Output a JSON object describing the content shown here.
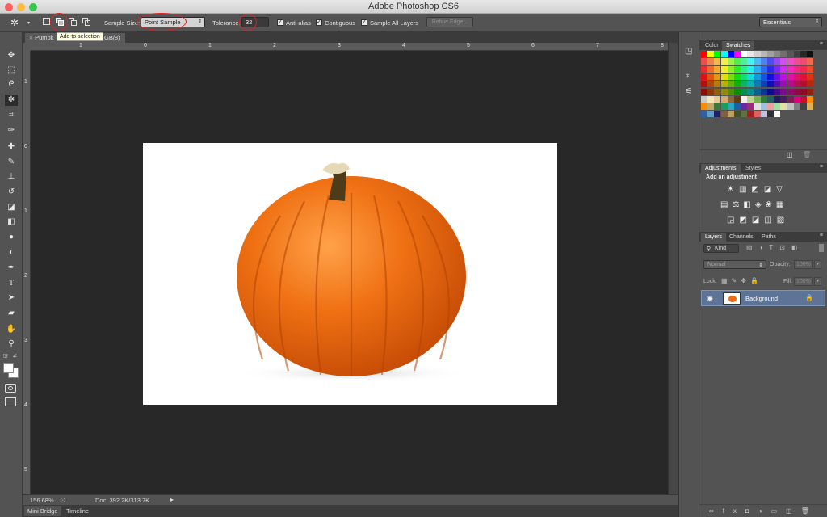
{
  "app_title": "Adobe Photoshop CS6",
  "options_bar": {
    "sample_size_label": "Sample Size:",
    "sample_size_value": "Point Sample",
    "tolerance_label": "Tolerance:",
    "tolerance_value": "32",
    "anti_alias_label": "Anti-alias",
    "contiguous_label": "Contiguous",
    "sample_all_layers_label": "Sample All Layers",
    "refine_edge_label": "Refine Edge...",
    "workspace_value": "Essentials",
    "tooltip": "Add to selection"
  },
  "document": {
    "tab_name_left": "Pumpk",
    "tab_name_right": "GB/8)",
    "ruler_h": [
      "1",
      "0",
      "1",
      "2",
      "3",
      "4",
      "5",
      "6",
      "7",
      "8"
    ],
    "ruler_v": [
      "1",
      "0",
      "1",
      "2",
      "3",
      "4",
      "5"
    ]
  },
  "status_bar": {
    "zoom": "156.68%",
    "doc_size": "Doc: 392.2K/313.7K"
  },
  "bottom_tabs": [
    "Mini Bridge",
    "Timeline"
  ],
  "color_panel": {
    "tabs": [
      "Color",
      "Swatches"
    ],
    "active_tab": "Swatches"
  },
  "adjustments_panel": {
    "tabs": [
      "Adjustments",
      "Styles"
    ],
    "heading": "Add an adjustment"
  },
  "layers_panel": {
    "tabs": [
      "Layers",
      "Channels",
      "Paths"
    ],
    "filter_label": "Kind",
    "blend_mode": "Normal",
    "opacity_label": "Opacity:",
    "opacity_value": "100%",
    "lock_label": "Lock:",
    "fill_label": "Fill:",
    "fill_value": "100%",
    "layers": [
      {
        "name": "Background",
        "visible": true,
        "locked": true
      }
    ]
  },
  "colors": {
    "foreground": "#ffffff",
    "background": "#ffffff",
    "selected_layer": "#5d7496",
    "highlight_ring": "#e02020",
    "pumpkin_orange": "#ef6a10"
  }
}
